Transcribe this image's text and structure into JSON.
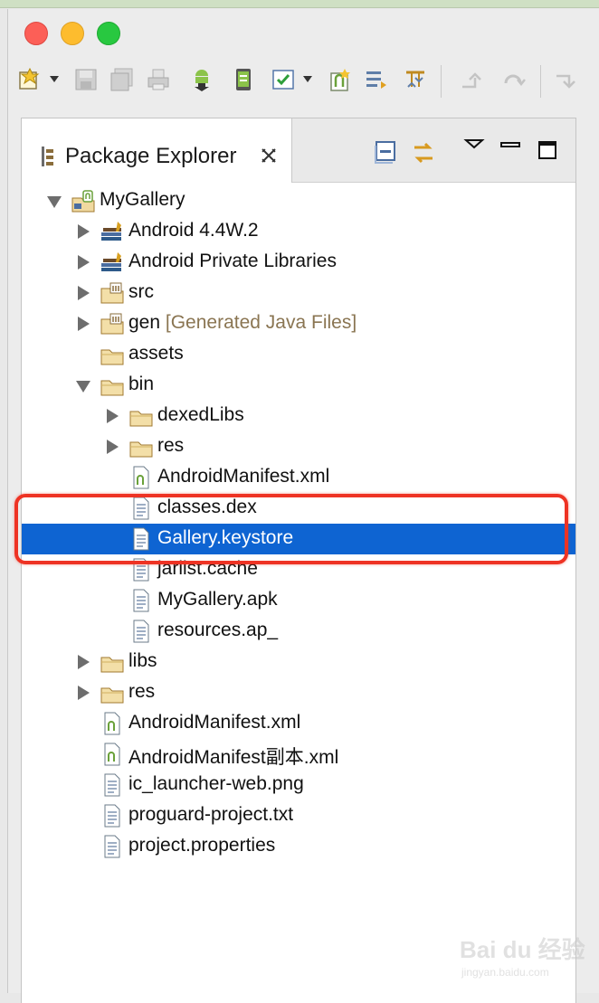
{
  "window": {
    "controls": [
      "close",
      "minimize",
      "zoom"
    ]
  },
  "toolbar": {
    "icons": [
      "new-wizard-icon",
      "save-icon",
      "save-all-icon",
      "print-icon",
      "android-sdk-manager-icon",
      "android-avd-manager-icon",
      "lint-check-icon",
      "new-android-project-icon",
      "new-xml-file-icon",
      "new-test-project-icon",
      "next-annotation-icon",
      "back-icon",
      "forward-icon"
    ]
  },
  "panel": {
    "title": "Package Explorer",
    "icons": [
      "package-explorer-icon",
      "close-tab-icon",
      "collapse-all-icon",
      "link-with-editor-icon",
      "view-menu-icon",
      "minimize-icon",
      "maximize-icon"
    ]
  },
  "tree": [
    {
      "label": "MyGallery",
      "icon": "android-project-icon",
      "expanded": true
    },
    {
      "label": "Android 4.4W.2",
      "icon": "library-icon"
    },
    {
      "label": "Android Private Libraries",
      "icon": "library-icon"
    },
    {
      "label": "src",
      "icon": "source-folder-icon"
    },
    {
      "label": "gen",
      "decoration": "[Generated Java Files]",
      "icon": "source-folder-icon"
    },
    {
      "label": "assets",
      "icon": "folder-icon"
    },
    {
      "label": "bin",
      "icon": "folder-icon",
      "expanded": true
    },
    {
      "label": "dexedLibs",
      "icon": "folder-icon"
    },
    {
      "label": "res",
      "icon": "folder-icon"
    },
    {
      "label": "AndroidManifest.xml",
      "icon": "xml-file-icon"
    },
    {
      "label": "classes.dex",
      "icon": "file-icon"
    },
    {
      "label": "Gallery.keystore",
      "icon": "file-icon",
      "selected": true
    },
    {
      "label": "jarlist.cache",
      "icon": "file-icon"
    },
    {
      "label": "MyGallery.apk",
      "icon": "file-icon"
    },
    {
      "label": "resources.ap_",
      "icon": "file-icon"
    },
    {
      "label": "libs",
      "icon": "folder-icon"
    },
    {
      "label": "res",
      "icon": "folder-icon"
    },
    {
      "label": "AndroidManifest.xml",
      "icon": "xml-file-icon"
    },
    {
      "label": "AndroidManifest副本.xml",
      "icon": "xml-file-icon"
    },
    {
      "label": "ic_launcher-web.png",
      "icon": "file-icon"
    },
    {
      "label": "proguard-project.txt",
      "icon": "file-icon"
    },
    {
      "label": "project.properties",
      "icon": "file-icon"
    }
  ],
  "watermark": {
    "brand": "Bai du 经验",
    "url": "jingyan.baidu.com"
  },
  "colors": {
    "selection": "#0e64d2",
    "highlight_box": "#ee3324",
    "decoration_text": "#8a7552"
  }
}
